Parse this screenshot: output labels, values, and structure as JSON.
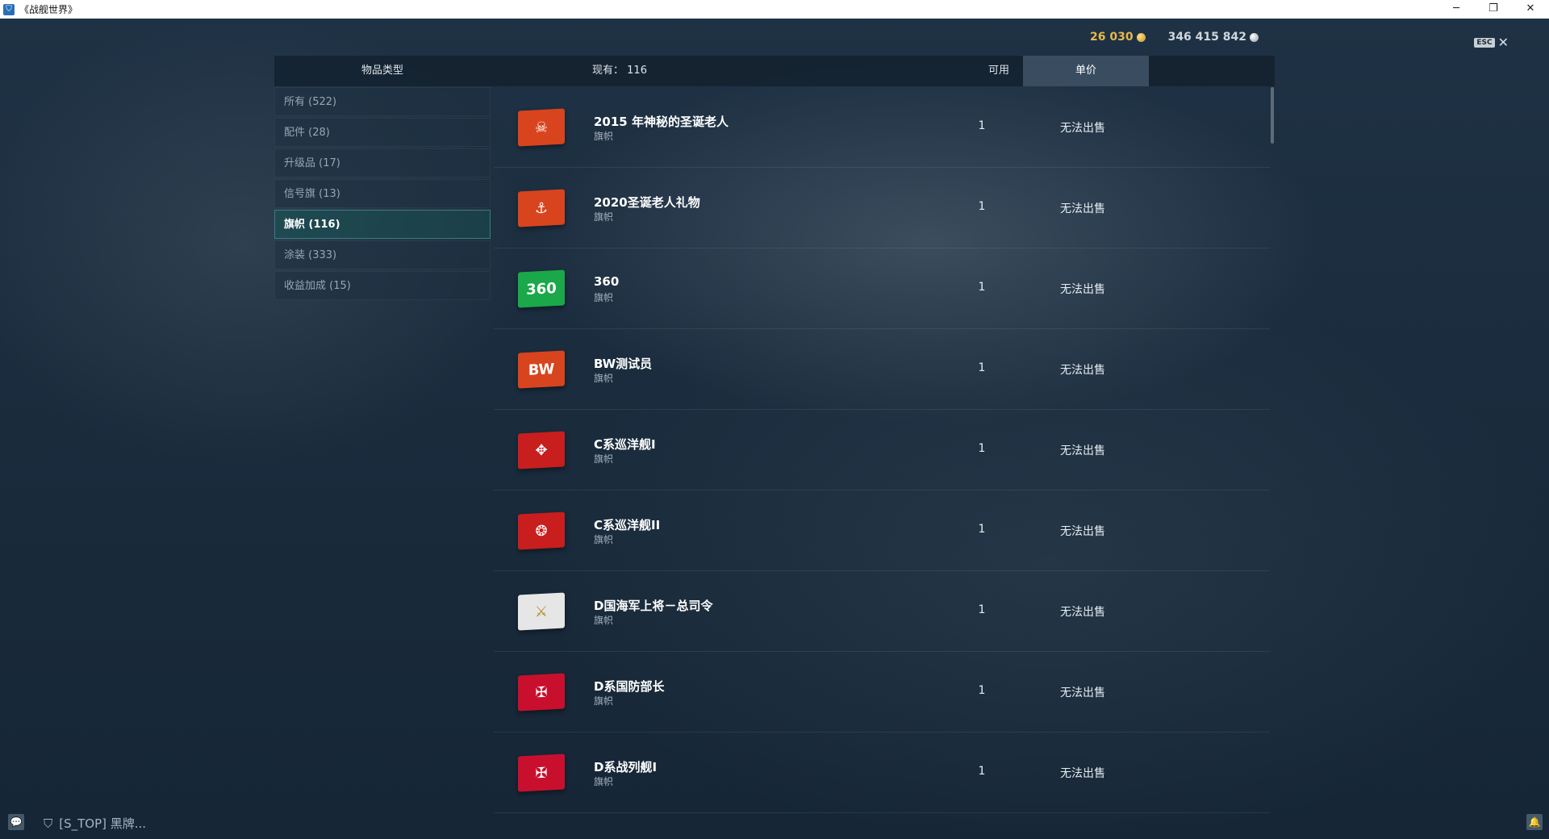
{
  "window": {
    "title": "《战舰世界》",
    "app_icon": "shield-icon",
    "controls": [
      "─",
      "❐",
      "✕"
    ]
  },
  "currency": {
    "gold": "26 030",
    "silver": "346 415 842",
    "gold_color": "#e8b84a",
    "silver_color": "#d0d6dc"
  },
  "close": {
    "key": "ESC",
    "icon": "✕"
  },
  "header": {
    "type_label": "物品类型",
    "count_label": "现有：",
    "count_value": "116",
    "available_label": "可用",
    "price_label": "单价"
  },
  "categories": [
    {
      "label": "所有 (522)",
      "active": false
    },
    {
      "label": "配件 (28)",
      "active": false
    },
    {
      "label": "升级品 (17)",
      "active": false
    },
    {
      "label": "信号旗 (13)",
      "active": false
    },
    {
      "label": "旗帜 (116)",
      "active": true
    },
    {
      "label": "涂装 (333)",
      "active": false
    },
    {
      "label": "收益加成 (15)",
      "active": false
    }
  ],
  "items": [
    {
      "name": "2015 年神秘的圣诞老人",
      "type": "旗帜",
      "available": "1",
      "price": "无法出售",
      "flag_color": "#d8441e",
      "icon": "santa-flag-icon",
      "glyph": "☠"
    },
    {
      "name": "2020圣诞老人礼物",
      "type": "旗帜",
      "available": "1",
      "price": "无法出售",
      "flag_color": "#d8441e",
      "icon": "anchor-flag-icon",
      "glyph": "⚓"
    },
    {
      "name": "360",
      "type": "旗帜",
      "available": "1",
      "price": "无法出售",
      "flag_color": "#1aa84a",
      "icon": "360-flag-icon",
      "glyph": "360"
    },
    {
      "name": "BW测试员",
      "type": "旗帜",
      "available": "1",
      "price": "无法出售",
      "flag_color": "#d8441e",
      "icon": "bw-flag-icon",
      "glyph": "BW"
    },
    {
      "name": "C系巡洋舰I",
      "type": "旗帜",
      "available": "1",
      "price": "无法出售",
      "flag_color": "#c81e1e",
      "icon": "ornament-flag-icon",
      "glyph": "✥"
    },
    {
      "name": "C系巡洋舰II",
      "type": "旗帜",
      "available": "1",
      "price": "无法出售",
      "flag_color": "#c81e1e",
      "icon": "emblem-flag-icon",
      "glyph": "❂"
    },
    {
      "name": "D国海军上将－总司令",
      "type": "旗帜",
      "available": "1",
      "price": "无法出售",
      "flag_color": "#e6e6e6",
      "icon": "crossed-swords-flag-icon",
      "glyph": "⚔"
    },
    {
      "name": "D系国防部长",
      "type": "旗帜",
      "available": "1",
      "price": "无法出售",
      "flag_color": "#c8102e",
      "icon": "iron-cross-flag-icon",
      "glyph": "✠"
    },
    {
      "name": "D系战列舰I",
      "type": "旗帜",
      "available": "1",
      "price": "无法出售",
      "flag_color": "#c8102e",
      "icon": "eagle-flag-icon",
      "glyph": "✠"
    }
  ],
  "bottom": {
    "chat_icon": "chat-icon",
    "clan_text": "[S_TOP] 黑牌...",
    "clan_icon": "clan-shield-icon",
    "bell_icon": "bell-icon"
  }
}
